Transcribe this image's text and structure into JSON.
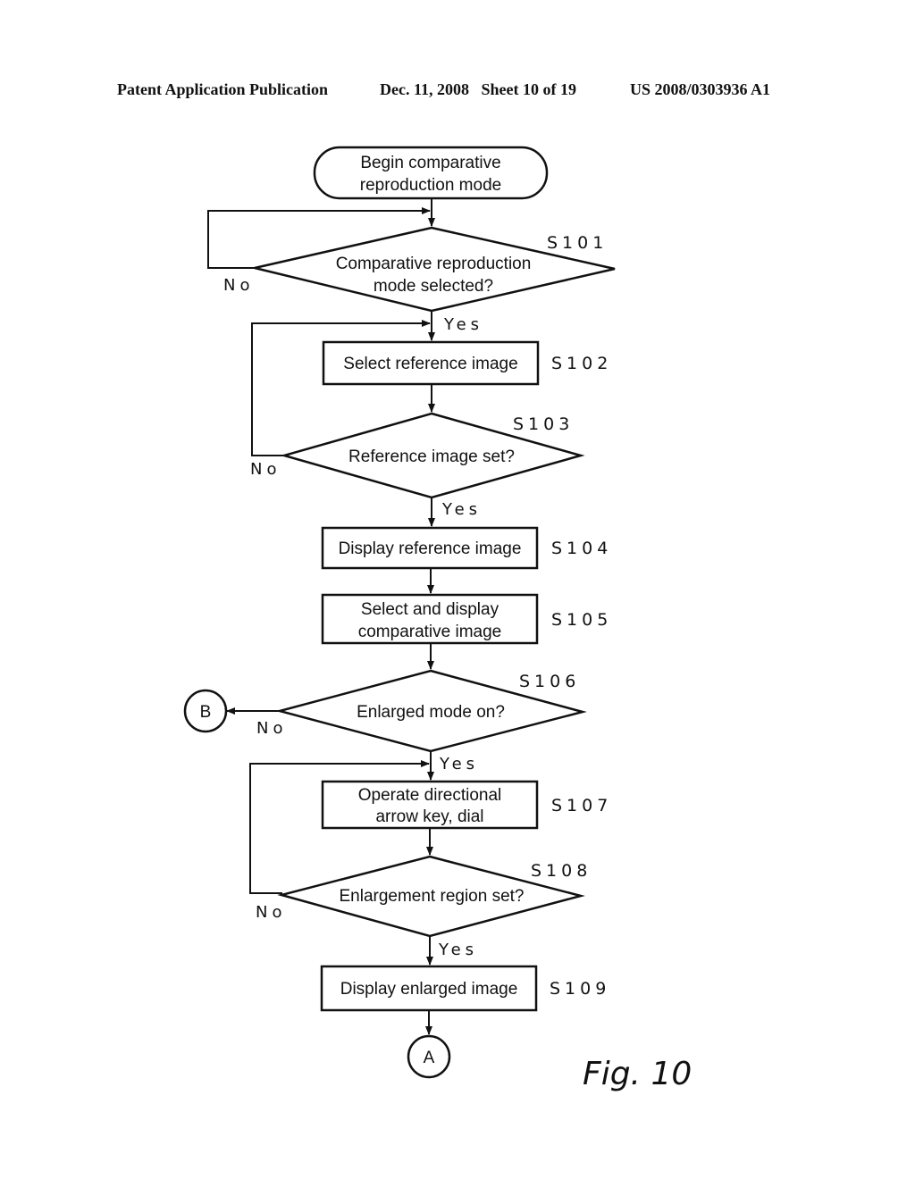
{
  "header": {
    "publication": "Patent Application Publication",
    "date_sheet": "Dec. 11, 2008   Sheet 10 of 19",
    "number": "US 2008/0303936 A1"
  },
  "flowchart": {
    "start": {
      "line1": "Begin comparative",
      "line2": "reproduction mode"
    },
    "steps": [
      {
        "id": "S101",
        "type": "decision",
        "line1": "Comparative reproduction",
        "line2": "mode selected?",
        "yes": "Yes",
        "no": "No"
      },
      {
        "id": "S102",
        "type": "process",
        "line1": "Select reference image"
      },
      {
        "id": "S103",
        "type": "decision",
        "line1": "Reference image set?",
        "yes": "Yes",
        "no": "No"
      },
      {
        "id": "S104",
        "type": "process",
        "line1": "Display reference image"
      },
      {
        "id": "S105",
        "type": "process",
        "line1": "Select and display",
        "line2": "comparative image"
      },
      {
        "id": "S106",
        "type": "decision",
        "line1": "Enlarged mode on?",
        "yes": "Yes",
        "no": "No"
      },
      {
        "id": "S107",
        "type": "process",
        "line1": "Operate directional",
        "line2": "arrow key, dial"
      },
      {
        "id": "S108",
        "type": "decision",
        "line1": "Enlargement region set?",
        "yes": "Yes",
        "no": "No"
      },
      {
        "id": "S109",
        "type": "process",
        "line1": "Display enlarged image"
      }
    ],
    "connectors": {
      "b": "B",
      "a": "A"
    },
    "figure_label": "Fig. 10"
  }
}
